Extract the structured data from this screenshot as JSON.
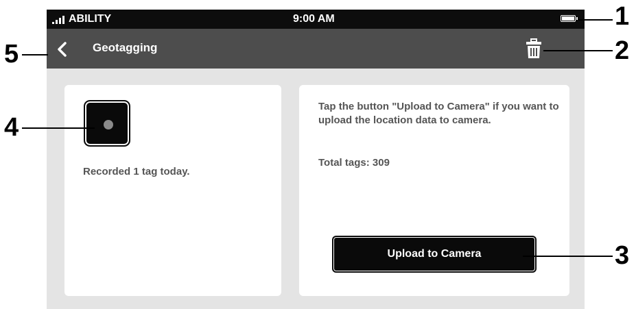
{
  "status_bar": {
    "carrier": "ABILITY",
    "time": "9:00 AM"
  },
  "nav_bar": {
    "title": "Geotagging"
  },
  "left_panel": {
    "recorded_text": "Recorded 1 tag today."
  },
  "right_panel": {
    "instruction_text": "Tap the button \"Upload to Camera\" if you want to upload the location data to camera.",
    "total_tags_text": "Total tags: 309",
    "upload_button_label": "Upload to Camera"
  },
  "callouts": {
    "c1": "1",
    "c2": "2",
    "c3": "3",
    "c4": "4",
    "c5": "5"
  },
  "icons": [
    "signal-icon",
    "battery-icon",
    "back-chevron-icon",
    "trash-icon",
    "record-icon"
  ]
}
